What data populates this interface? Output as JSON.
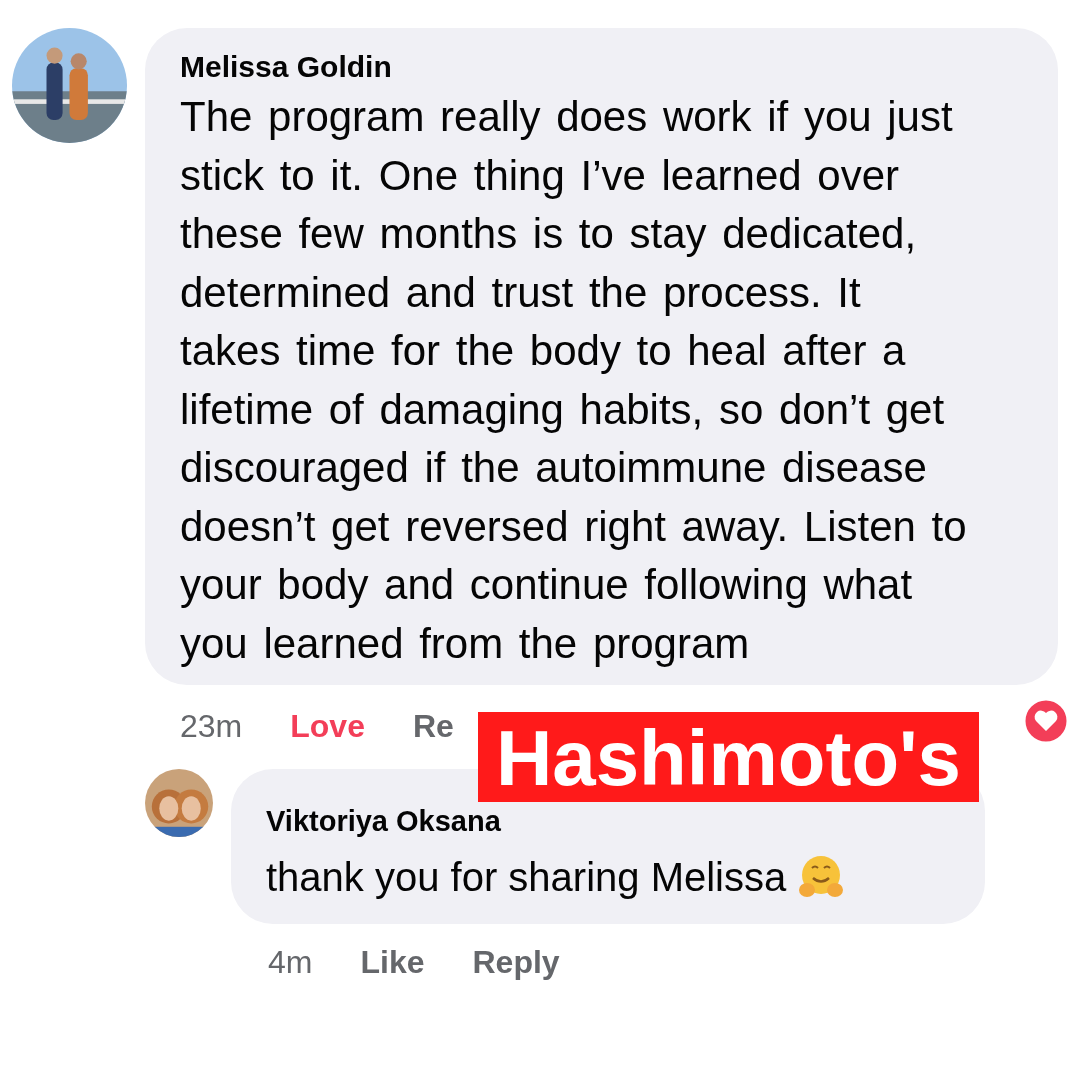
{
  "comments": [
    {
      "author": "Melissa Goldin",
      "text": "The program really does work if you just stick to it. One thing I’ve learned over these few months is to stay dedicated, determined and trust the process. It takes time for the body to heal after a lifetime of damaging habits, so don’t get discouraged if the autoimmune disease doesn’t get reversed right away. Listen to your body and continue following what you learned from the program",
      "time": "23m",
      "actions": [
        {
          "label": "Love",
          "selected": true
        },
        {
          "label": "Re",
          "selected": false
        }
      ],
      "reaction": {
        "kind": "heart"
      }
    },
    {
      "author": "Viktoriya Oksana",
      "text": "thank you for sharing Melissa",
      "emoji": {
        "kind": "hug"
      },
      "time": "4m",
      "actions": [
        {
          "label": "Like",
          "selected": false
        },
        {
          "label": "Reply",
          "selected": false
        }
      ]
    }
  ],
  "banner": {
    "text": "Hashimoto's"
  }
}
